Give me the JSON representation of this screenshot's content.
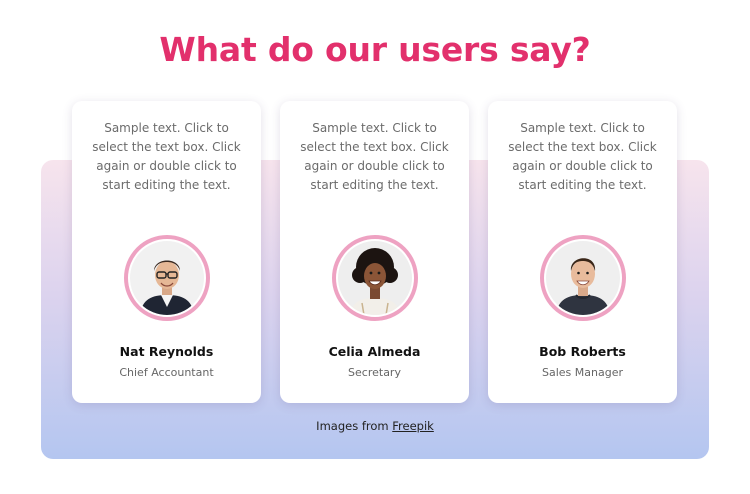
{
  "heading": "What do our users say?",
  "colors": {
    "heading": "#e2306c",
    "avatar_ring": "#eea2c2",
    "panel_top": "#f7e4ed",
    "panel_bottom": "#b4c6f0"
  },
  "testimonials": [
    {
      "quote": "Sample text. Click to select the text box. Click again or double click to start editing the text.",
      "name": "Nat Reynolds",
      "role": "Chief Accountant",
      "avatar_icon": "man-with-glasses-portrait"
    },
    {
      "quote": "Sample text. Click to select the text box. Click again or double click to start editing the text.",
      "name": "Celia Almeda",
      "role": "Secretary",
      "avatar_icon": "woman-curly-hair-portrait"
    },
    {
      "quote": "Sample text. Click to select the text box. Click again or double click to start editing the text.",
      "name": "Bob Roberts",
      "role": "Sales Manager",
      "avatar_icon": "man-smiling-portrait"
    }
  ],
  "credit": {
    "prefix": "Images from",
    "link_label": "Freepik"
  }
}
